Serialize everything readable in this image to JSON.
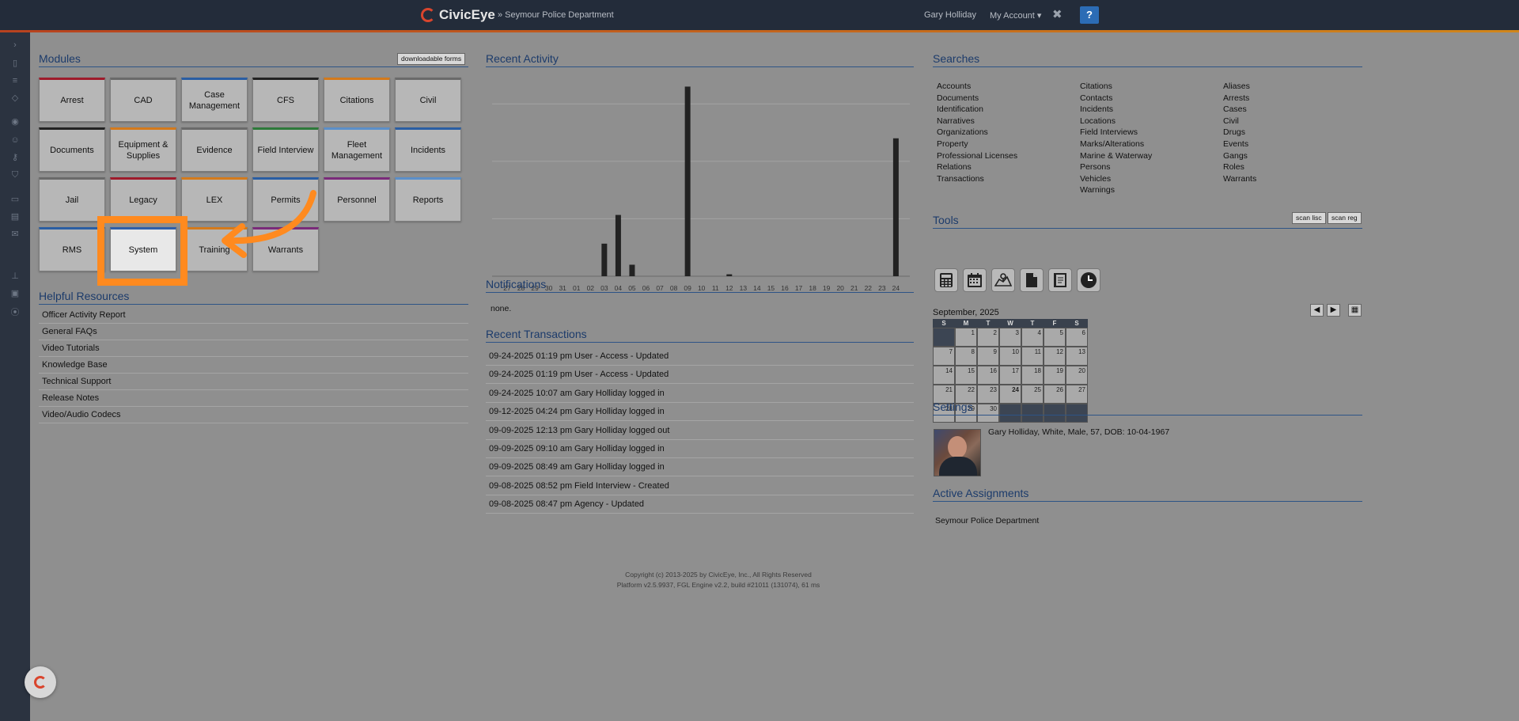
{
  "header": {
    "brand": "CivicEye",
    "department": "» Seymour Police Department",
    "user_name": "Gary Holliday",
    "my_account": "My Account ▾",
    "close_glyph": "✖",
    "help_glyph": "?"
  },
  "sidebar_icons": [
    "chevron-right-icon",
    "document-icon",
    "list-icon",
    "alert-icon",
    "user-circle-icon",
    "user-gear-icon",
    "key-icon",
    "shield-icon",
    "inbox-icon",
    "id-card-icon",
    "mail-icon",
    "org-chart-icon",
    "vehicle-icon",
    "location-pin-icon"
  ],
  "modules": {
    "title": "Modules",
    "downloadable_forms": "downloadable forms",
    "tiles": [
      {
        "label": "Arrest",
        "color": "#9e1b2b"
      },
      {
        "label": "CAD",
        "color": "#6a6a6a"
      },
      {
        "label": "Case Management",
        "color": "#2a5ea3"
      },
      {
        "label": "CFS",
        "color": "#222222"
      },
      {
        "label": "Citations",
        "color": "#d47a1b"
      },
      {
        "label": "Civil",
        "color": "#6a6a6a"
      },
      {
        "label": "Documents",
        "color": "#222222"
      },
      {
        "label": "Equipment & Supplies",
        "color": "#d47a1b"
      },
      {
        "label": "Evidence",
        "color": "#6a6a6a"
      },
      {
        "label": "Field Interview",
        "color": "#2d7a3a"
      },
      {
        "label": "Fleet Management",
        "color": "#5b8fc9"
      },
      {
        "label": "Incidents",
        "color": "#2a5ea3"
      },
      {
        "label": "Jail",
        "color": "#6a6a6a"
      },
      {
        "label": "Legacy",
        "color": "#9e1b2b"
      },
      {
        "label": "LEX",
        "color": "#d47a1b"
      },
      {
        "label": "Permits",
        "color": "#2a5ea3"
      },
      {
        "label": "Personnel",
        "color": "#7a2b7a"
      },
      {
        "label": "Reports",
        "color": "#5b8fc9"
      },
      {
        "label": "RMS",
        "color": "#2a5ea3"
      },
      {
        "label": "System",
        "color": "#2a5ea3"
      },
      {
        "label": "Training",
        "color": "#d47a1b"
      },
      {
        "label": "Warrants",
        "color": "#7a2b7a"
      }
    ]
  },
  "helpful_resources": {
    "title": "Helpful Resources",
    "items": [
      "Officer Activity Report",
      "General FAQs",
      "Video Tutorials",
      "Knowledge Base",
      "Technical Support",
      "Release Notes",
      "Video/Audio Codecs"
    ]
  },
  "recent_activity": {
    "title": "Recent Activity"
  },
  "chart_data": {
    "type": "bar",
    "categories": [
      "27",
      "28",
      "29",
      "30",
      "31",
      "01",
      "02",
      "03",
      "04",
      "05",
      "06",
      "07",
      "08",
      "09",
      "10",
      "11",
      "12",
      "13",
      "14",
      "15",
      "16",
      "17",
      "18",
      "19",
      "20",
      "21",
      "22",
      "23",
      "24"
    ],
    "values": [
      0,
      0,
      0,
      0,
      0,
      0,
      0,
      17,
      32,
      6,
      0,
      0,
      0,
      99,
      0,
      0,
      1,
      0,
      0,
      0,
      0,
      0,
      0,
      0,
      0,
      0,
      0,
      0,
      72
    ],
    "ylim": [
      0,
      100
    ],
    "gridlines": [
      0,
      30,
      60,
      90
    ],
    "grid": true,
    "bar_color": "#222222"
  },
  "notifications": {
    "title": "Notifications",
    "text": "none."
  },
  "recent_transactions": {
    "title": "Recent Transactions",
    "rows": [
      {
        "date": "09-24-2025 01:19 pm",
        "desc": "User - Access - Updated"
      },
      {
        "date": "09-24-2025 01:19 pm",
        "desc": "User - Access - Updated"
      },
      {
        "date": "09-24-2025 10:07 am",
        "desc": "Gary Holliday logged in"
      },
      {
        "date": "09-12-2025 04:24 pm",
        "desc": "Gary Holliday logged in"
      },
      {
        "date": "09-09-2025 12:13 pm",
        "desc": "Gary Holliday logged out"
      },
      {
        "date": "09-09-2025 09:10 am",
        "desc": "Gary Holliday logged in"
      },
      {
        "date": "09-09-2025 08:49 am",
        "desc": "Gary Holliday logged in"
      },
      {
        "date": "09-08-2025 08:52 pm",
        "desc": "Field Interview - Created"
      },
      {
        "date": "09-08-2025 08:47 pm",
        "desc": "Agency - Updated"
      }
    ]
  },
  "searches": {
    "title": "Searches",
    "col1": [
      "Accounts",
      "Documents",
      "Identification",
      "Narratives",
      "Organizations",
      "Property",
      "Professional Licenses",
      "Relations",
      "Transactions"
    ],
    "col2": [
      "Citations",
      "Contacts",
      "Incidents",
      "Locations",
      "Field Interviews",
      "Marks/Alterations",
      "Marine & Waterway",
      "Persons",
      "Vehicles",
      "Warnings"
    ],
    "col3": [
      "Aliases",
      "Arrests",
      "Cases",
      "Civil",
      "Drugs",
      "Events",
      "Gangs",
      "Roles",
      "Warrants"
    ]
  },
  "tools": {
    "title": "Tools",
    "scan_lisc": "scan lisc",
    "scan_reg": "scan reg",
    "icons": [
      "calculator-icon",
      "calendar-icon",
      "map-icon",
      "document-icon",
      "notebook-icon",
      "clock-icon"
    ]
  },
  "calendar": {
    "title": "September, 2025",
    "prev": "◀",
    "next": "▶",
    "grid_glyph": "▦",
    "weekdays": [
      "S",
      "M",
      "T",
      "W",
      "T",
      "F",
      "S"
    ],
    "weeks": [
      [
        "",
        "1",
        "2",
        "3",
        "4",
        "5",
        "6"
      ],
      [
        "7",
        "8",
        "9",
        "10",
        "11",
        "12",
        "13"
      ],
      [
        "14",
        "15",
        "16",
        "17",
        "18",
        "19",
        "20"
      ],
      [
        "21",
        "22",
        "23",
        "24",
        "25",
        "26",
        "27"
      ],
      [
        "28",
        "29",
        "30",
        "",
        "",
        "",
        ""
      ]
    ],
    "today": "24"
  },
  "settings": {
    "title": "Settings",
    "profile_text": "Gary Holliday, White, Male, 57, DOB: 10-04-1967"
  },
  "active_assignments": {
    "title": "Active Assignments",
    "item": "Seymour Police Department"
  },
  "footer": {
    "line1": "Copyright (c) 2013-2025 by CivicEye, Inc., All Rights Reserved",
    "line2": "Platform v2.5.9937, FGL Engine v2.2, build #21011 (131074), 61 ms"
  },
  "colors": {
    "accent_highlight": "#ff8a1f",
    "topbar": "#232c3a",
    "link_heading": "#1c3b6b"
  }
}
